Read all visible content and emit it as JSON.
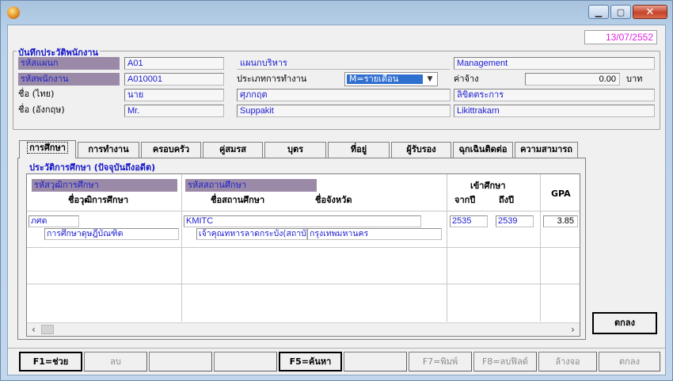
{
  "header": {
    "date": "13/07/2552",
    "group_title": "บันทึกประวัติพนักงาน"
  },
  "employee": {
    "dept_label": "รหัสแผนก",
    "dept_code": "A01",
    "dept_name_th": "แผนกบริหาร",
    "dept_name_en": "Management",
    "emp_code_label": "รหัสพนักงาน",
    "emp_code": "A010001",
    "emp_type_label": "ประเภทการทำงาน",
    "emp_type_value": "M=รายเดือน",
    "wage_label": "ค่าจ้าง",
    "wage_value": "0.00",
    "wage_unit": "บาท",
    "name_th_label": "ชื่อ (ไทย)",
    "title_th": "นาย",
    "first_th": "ศุภกฤต",
    "last_th": "ลิขิตตระการ",
    "name_en_label": "ชื่อ (อังกฤษ)",
    "title_en": "Mr.",
    "first_en": "Suppakit",
    "last_en": "Likittrakarn"
  },
  "tabs": [
    "การศึกษา",
    "การทำงาน",
    "ครอบครัว",
    "คู่สมรส",
    "บุตร",
    "ที่อยู่",
    "ผู้รับรอง",
    "ฉุกเฉินติดต่อ",
    "ความสามารถ"
  ],
  "education": {
    "title": "ประวัติการศึกษา (ปัจจุบันถึงอดีต)",
    "headers": {
      "degree_code": "รหัสวุฒิการศึกษา",
      "degree_name": "ชื่อวุฒิการศึกษา",
      "school_code": "รหัสสถานศึกษา",
      "school_name": "ชื่อสถานศึกษา",
      "province": "ชื่อจังหวัด",
      "enrolled": "เข้าศึกษา",
      "from_year": "จากปี",
      "to_year": "ถึงปี",
      "gpa": "GPA"
    },
    "rows": [
      {
        "degree_code": "ภศด",
        "degree_name": "การศึกษาดุษฎีบัณฑิต",
        "school_code": "KMITC",
        "school_name": "เจ้าคุณทหารลาดกระบัง(สถาบัน",
        "province": "กรุงเทพมหานคร",
        "from_year": "2535",
        "to_year": "2539",
        "gpa": "3.85"
      }
    ]
  },
  "ok_label": "ตกลง",
  "toolbar": [
    "F1=ช่วย",
    "ลบ",
    "",
    "",
    "F5=ค้นหา",
    "",
    "F7=พิมพ์",
    "F8=ลบฟิลด์",
    "ล้างจอ",
    "ตกลง"
  ]
}
